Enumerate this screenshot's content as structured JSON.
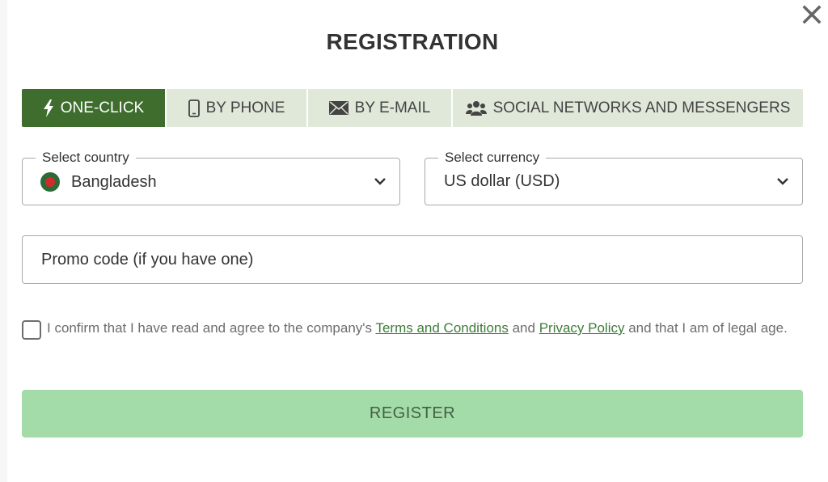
{
  "dialog": {
    "title": "REGISTRATION",
    "close_icon": "close-icon"
  },
  "tabs": [
    {
      "label": "ONE-CLICK",
      "icon": "lightning-icon",
      "active": true
    },
    {
      "label": "BY PHONE",
      "icon": "phone-icon",
      "active": false
    },
    {
      "label": "BY E-MAIL",
      "icon": "envelope-icon",
      "active": false
    },
    {
      "label": "SOCIAL NETWORKS AND MESSENGERS",
      "icon": "users-icon",
      "active": false
    }
  ],
  "country": {
    "legend": "Select country",
    "value": "Bangladesh",
    "icon": "bangladesh-flag-icon"
  },
  "currency": {
    "legend": "Select currency",
    "value": "US dollar (USD)"
  },
  "promo": {
    "placeholder": "Promo code (if you have one)"
  },
  "agreement": {
    "text_before": "I confirm that I have read and agree to the company's ",
    "terms_link": "Terms and Conditions",
    "text_middle": " and ",
    "privacy_link": "Privacy Policy",
    "text_after": " and that I am of legal age.",
    "checked": false
  },
  "register_button": {
    "label": "REGISTER"
  },
  "colors": {
    "active_tab": "#3e6d2e",
    "tab_bg": "#dfe8d9",
    "link": "#3e7c3a",
    "register_bg": "#a3dca8"
  }
}
